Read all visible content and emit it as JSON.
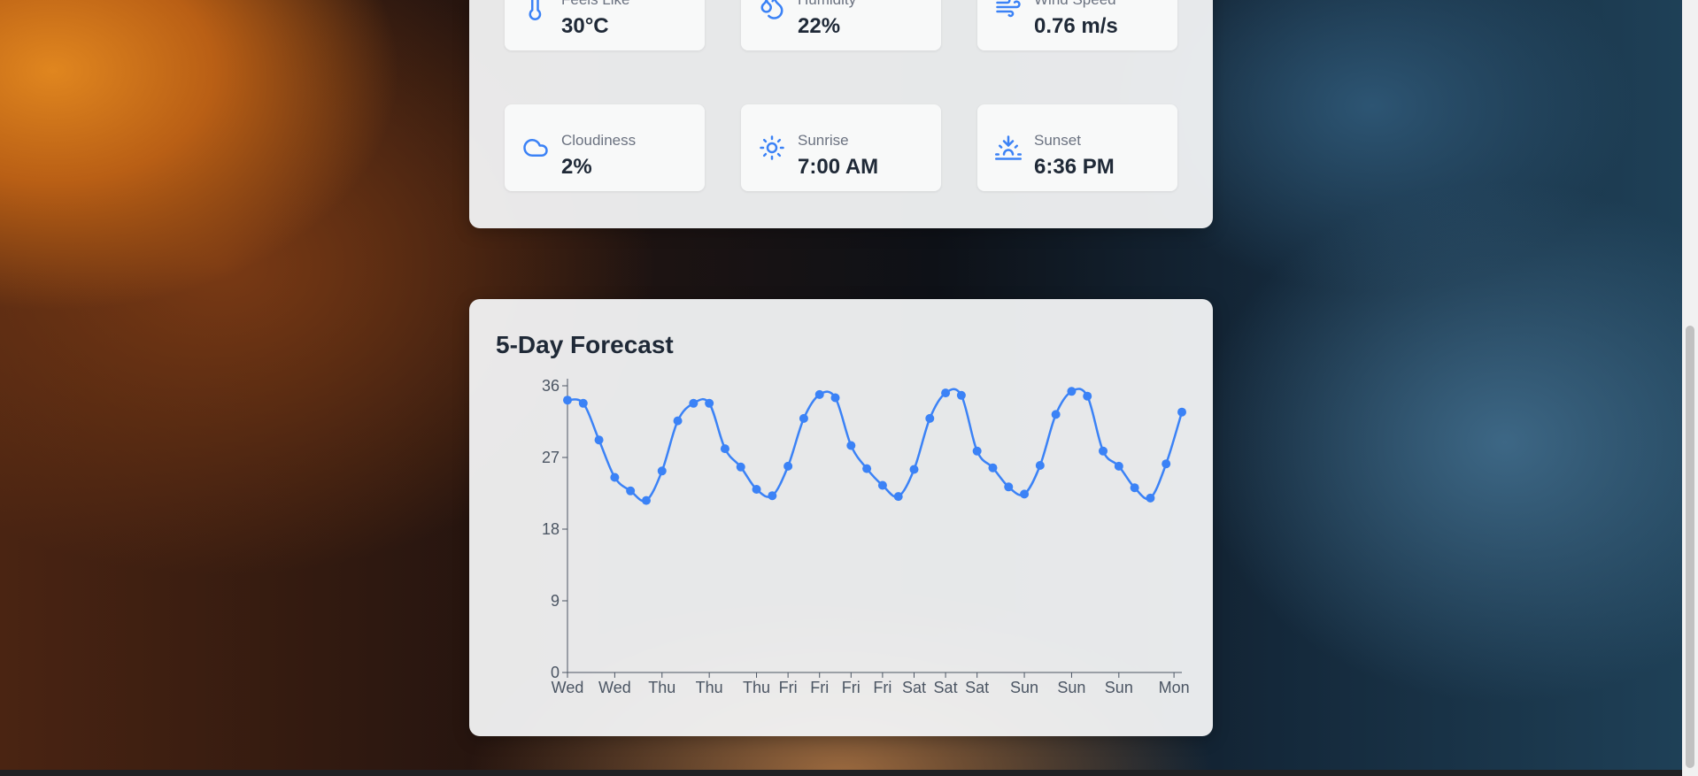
{
  "details": {
    "cards": [
      {
        "label": "Feels Like",
        "value": "30°C",
        "icon": "thermometer-icon"
      },
      {
        "label": "Humidity",
        "value": "22%",
        "icon": "droplets-icon"
      },
      {
        "label": "Wind Speed",
        "value": "0.76 m/s",
        "icon": "wind-icon"
      },
      {
        "label": "Cloudiness",
        "value": "2%",
        "icon": "cloud-icon"
      },
      {
        "label": "Sunrise",
        "value": "7:00 AM",
        "icon": "sun-icon"
      },
      {
        "label": "Sunset",
        "value": "6:36 PM",
        "icon": "sunset-icon"
      }
    ]
  },
  "forecast": {
    "title": "5-Day Forecast"
  },
  "colors": {
    "accent": "#3b82f6",
    "text_primary": "#1f2937",
    "text_secondary": "#6b7280"
  },
  "chart_data": {
    "type": "line",
    "title": "5-Day Forecast",
    "xlabel": "",
    "ylabel": "",
    "ylim": [
      0,
      36
    ],
    "yticks": [
      0,
      9,
      18,
      27,
      36
    ],
    "grid": false,
    "x_tick_labels": [
      "Wed",
      "Wed",
      "Thu",
      "Thu",
      "Thu",
      "Fri",
      "Fri",
      "Fri",
      "Fri",
      "Sat",
      "Sat",
      "Sat",
      "Sun",
      "Sun",
      "Sun",
      "Mon"
    ],
    "x_tick_positions": [
      0,
      3,
      6,
      9,
      12,
      14,
      16,
      18,
      20,
      22,
      24,
      26,
      29,
      32,
      35,
      38.5
    ],
    "series": [
      {
        "values": [
          34.2,
          33.8,
          29.2,
          24.5,
          22.8,
          21.6,
          25.3,
          31.6,
          33.8,
          33.8,
          28.1,
          25.8,
          23.0,
          22.2,
          25.9,
          31.9,
          34.9,
          34.5,
          28.5,
          25.6,
          23.5,
          22.1,
          25.5,
          31.9,
          35.1,
          34.8,
          27.8,
          25.7,
          23.3,
          22.4,
          26.0,
          32.4,
          35.3,
          34.7,
          27.8,
          25.9,
          23.2,
          21.9,
          26.2,
          32.7
        ]
      }
    ]
  }
}
